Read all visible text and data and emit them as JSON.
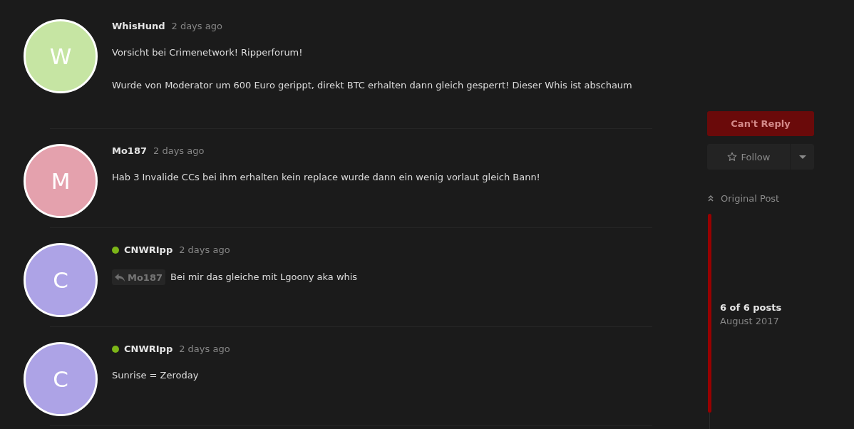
{
  "posts": [
    {
      "avatar": {
        "letter": "W",
        "color": "#c6e5a3"
      },
      "username": "WhisHund",
      "online": false,
      "time": "2 days ago",
      "paragraphs": [
        "Vorsicht bei Crimenetwork! Ripperforum!",
        "Wurde von Moderator um 600 Euro gerippt, direkt BTC erhalten dann gleich gesperrt! Dieser Whis ist abschaum"
      ]
    },
    {
      "avatar": {
        "letter": "M",
        "color": "#e4a1ad"
      },
      "username": "Mo187",
      "online": false,
      "time": "2 days ago",
      "paragraphs": [
        "Hab 3 Invalide CCs bei ihm erhalten kein replace wurde dann ein wenig vorlaut gleich Bann!"
      ]
    },
    {
      "avatar": {
        "letter": "C",
        "color": "#ada3e6"
      },
      "username": "CNWRIpp",
      "online": true,
      "time": "2 days ago",
      "reply_to": "Mo187",
      "paragraphs": [
        "Bei mir das gleiche mit Lgoony aka whis"
      ]
    },
    {
      "avatar": {
        "letter": "C",
        "color": "#ada3e6"
      },
      "username": "CNWRIpp",
      "online": true,
      "time": "2 days ago",
      "paragraphs": [
        "Sunrise = Zeroday"
      ]
    }
  ],
  "sidebar": {
    "reply_button": {
      "label": "Can't Reply",
      "disabled": true
    },
    "follow_button": {
      "label": "Follow"
    },
    "original_post_link": "Original Post",
    "scrubber": {
      "position": "6 of 6 posts",
      "date": "August 2017"
    }
  }
}
